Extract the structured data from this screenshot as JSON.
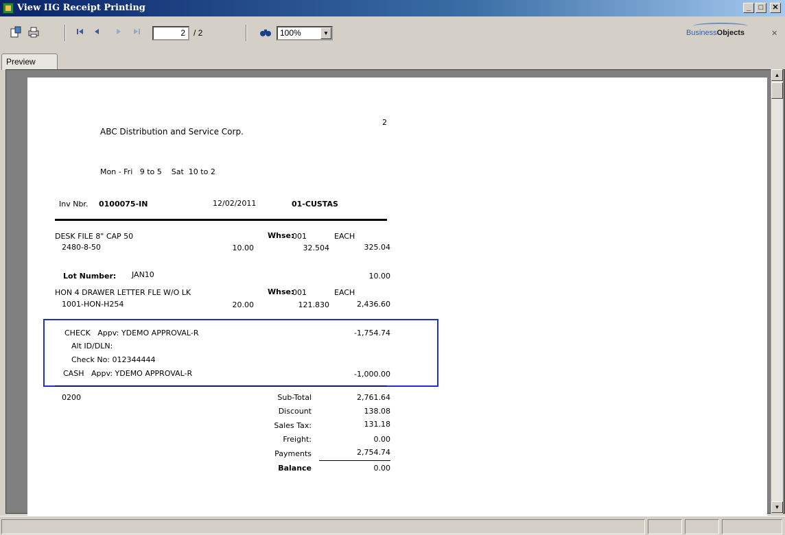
{
  "window": {
    "title": "View IIG Receipt Printing",
    "minimize": "_",
    "maximize": "□",
    "close": "✕"
  },
  "toolbar": {
    "page_current": "2",
    "page_total": "/ 2",
    "zoom": "100%",
    "brand_prefix": "Business",
    "brand_suffix": "Objects",
    "panel_close": "✕"
  },
  "tab": {
    "label": "Preview"
  },
  "report": {
    "page_number": "2",
    "company": "ABC Distribution and Service Corp.",
    "hours": "Mon - Fri   9 to 5    Sat  10 to 2",
    "inv_label": "Inv Nbr.",
    "inv_number": "0100075-IN",
    "inv_date": "12/02/2011",
    "customer": "01-CUSTAS",
    "lines": [
      {
        "desc": "DESK FILE 8\" CAP 50",
        "whse_label": "Whse:",
        "whse": "001",
        "unit": "EACH",
        "item": "2480-8-50",
        "qty": "10.00",
        "price": "32.504",
        "ext": "325.04"
      },
      {
        "desc": "HON 4 DRAWER LETTER FLE W/O LK",
        "whse_label": "Whse:",
        "whse": "001",
        "unit": "EACH",
        "item": "1001-HON-H254",
        "qty": "20.00",
        "price": "121.830",
        "ext": "2,436.60"
      }
    ],
    "lot_label": "Lot Number:",
    "lot_value": "JAN10",
    "lot_qty": "10.00",
    "payments": [
      {
        "text": "CHECK   Appv: YDEMO APPROVAL-R",
        "amount": "-1,754.74"
      },
      {
        "text": "CASH   Appv: YDEMO APPROVAL-R",
        "amount": "-1,000.00"
      }
    ],
    "alt_id": "Alt ID/DLN:",
    "check_no": "Check No: 012344444",
    "footer_code": "0200",
    "totals": [
      {
        "label": "Sub-Total",
        "value": "2,761.64"
      },
      {
        "label": "Discount",
        "value": "138.08"
      },
      {
        "label": "Sales Tax:",
        "value": "131.18"
      },
      {
        "label": "Freight:",
        "value": "0.00"
      },
      {
        "label": "Payments",
        "value": "2,754.74"
      },
      {
        "label": "Balance",
        "value": "0.00"
      }
    ]
  },
  "colors": {
    "highlight": "#1a2fd0",
    "titlebar": "#0a246a"
  }
}
